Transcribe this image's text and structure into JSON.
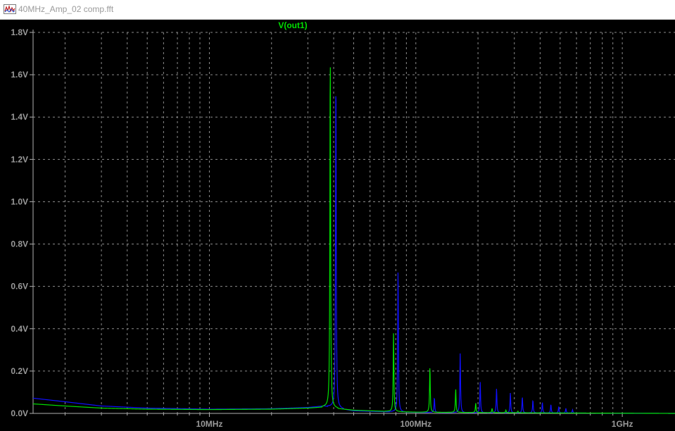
{
  "window": {
    "title": "40MHz_Amp_02 comp.fft",
    "icon": "waveform-icon"
  },
  "colors": {
    "background": "#000000",
    "grid": "#8a8a8a",
    "axis": "#b0b0b0",
    "tick_text": "#9a9a9a",
    "series_out1": "#00e000",
    "series_blue": "#1010ff"
  },
  "chart_data": {
    "type": "line",
    "title": "",
    "legend": [
      {
        "text": "V(out1)",
        "color": "#00e000",
        "placement": "top-center"
      }
    ],
    "xscale": "log",
    "xlim": [
      1400000,
      1800000000
    ],
    "ylim": [
      0,
      1.8
    ],
    "xlabel": "",
    "ylabel": "",
    "grid": true,
    "y_ticks": [
      {
        "value": 0.0,
        "label": "0.0V"
      },
      {
        "value": 0.2,
        "label": "0.2V"
      },
      {
        "value": 0.4,
        "label": "0.4V"
      },
      {
        "value": 0.6,
        "label": "0.6V"
      },
      {
        "value": 0.8,
        "label": "0.8V"
      },
      {
        "value": 1.0,
        "label": "1.0V"
      },
      {
        "value": 1.2,
        "label": "1.2V"
      },
      {
        "value": 1.4,
        "label": "1.4V"
      },
      {
        "value": 1.6,
        "label": "1.6V"
      },
      {
        "value": 1.8,
        "label": "1.8V"
      }
    ],
    "x_ticks": [
      {
        "value": 10000000,
        "label": "10MHz"
      },
      {
        "value": 100000000,
        "label": "100MHz"
      },
      {
        "value": 1000000000,
        "label": "1GHz"
      }
    ],
    "series": [
      {
        "name": "V(out1)",
        "color": "#00e000",
        "baseline": [
          [
            1400000,
            0.045
          ],
          [
            2000000,
            0.035
          ],
          [
            3000000,
            0.025
          ],
          [
            5000000,
            0.02
          ],
          [
            10000000,
            0.018
          ],
          [
            20000000,
            0.02
          ],
          [
            30000000,
            0.025
          ],
          [
            36000000,
            0.03
          ],
          [
            50000000,
            0.015
          ],
          [
            70000000,
            0.01
          ],
          [
            100000000,
            0.006
          ],
          [
            200000000,
            0.004
          ],
          [
            500000000,
            0.002
          ],
          [
            1800000000,
            0.0
          ]
        ],
        "peaks": [
          [
            38500000,
            1.69
          ],
          [
            78000000,
            0.37
          ],
          [
            117000000,
            0.215
          ],
          [
            156000000,
            0.11
          ],
          [
            195000000,
            0.045
          ],
          [
            234000000,
            0.02
          ],
          [
            273000000,
            0.012
          ],
          [
            312000000,
            0.008
          ]
        ]
      },
      {
        "name": "",
        "color": "#1010ff",
        "baseline": [
          [
            1400000,
            0.072
          ],
          [
            2000000,
            0.055
          ],
          [
            3000000,
            0.035
          ],
          [
            5000000,
            0.025
          ],
          [
            10000000,
            0.02
          ],
          [
            20000000,
            0.022
          ],
          [
            30000000,
            0.028
          ],
          [
            36000000,
            0.035
          ],
          [
            50000000,
            0.012
          ],
          [
            70000000,
            0.008
          ],
          [
            100000000,
            0.005
          ],
          [
            200000000,
            0.003
          ],
          [
            500000000,
            0.002
          ],
          [
            1800000000,
            0.0
          ]
        ],
        "peaks": [
          [
            41000000,
            1.6
          ],
          [
            82000000,
            0.67
          ],
          [
            123000000,
            0.07
          ],
          [
            164000000,
            0.28
          ],
          [
            205000000,
            0.145
          ],
          [
            246000000,
            0.115
          ],
          [
            287000000,
            0.095
          ],
          [
            328000000,
            0.075
          ],
          [
            369000000,
            0.06
          ],
          [
            410000000,
            0.05
          ],
          [
            451000000,
            0.04
          ],
          [
            492000000,
            0.03
          ],
          [
            533000000,
            0.022
          ],
          [
            574000000,
            0.015
          ]
        ]
      }
    ]
  }
}
